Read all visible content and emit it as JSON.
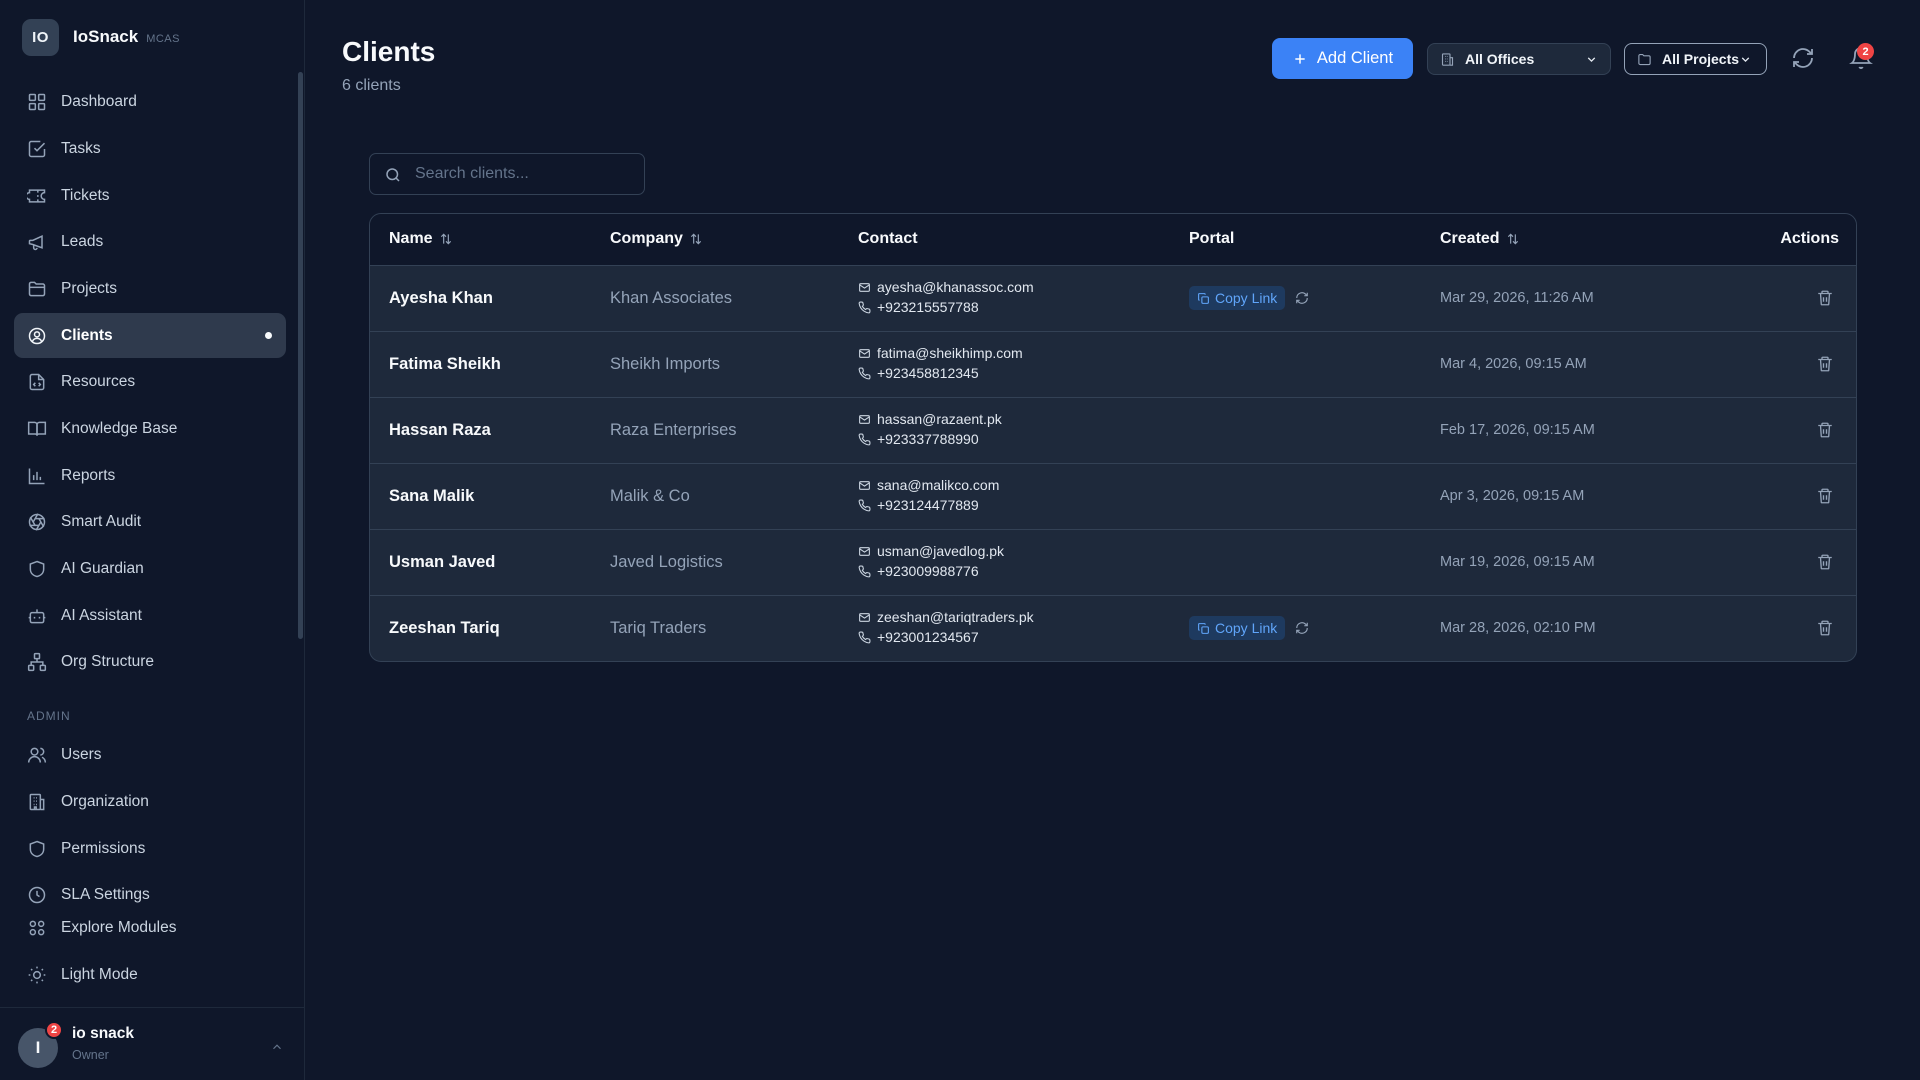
{
  "brand": {
    "logo_text": "IO",
    "name": "IoSnack",
    "tag": "MCAS"
  },
  "sidebar": {
    "items": [
      {
        "label": "Dashboard",
        "icon": "grid-icon"
      },
      {
        "label": "Tasks",
        "icon": "checkbox-icon"
      },
      {
        "label": "Tickets",
        "icon": "ticket-icon"
      },
      {
        "label": "Leads",
        "icon": "megaphone-icon"
      },
      {
        "label": "Projects",
        "icon": "folder-icon"
      },
      {
        "label": "Clients",
        "icon": "user-circle-icon",
        "active": true
      },
      {
        "label": "Resources",
        "icon": "file-icon"
      },
      {
        "label": "Knowledge Base",
        "icon": "book-icon"
      },
      {
        "label": "Reports",
        "icon": "bar-chart-icon"
      },
      {
        "label": "Smart Audit",
        "icon": "aperture-icon"
      },
      {
        "label": "AI Guardian",
        "icon": "shield-icon"
      },
      {
        "label": "AI Assistant",
        "icon": "bot-icon"
      },
      {
        "label": "Org Structure",
        "icon": "network-icon"
      }
    ],
    "admin_label": "ADMIN",
    "admin_items": [
      {
        "label": "Users",
        "icon": "users-icon"
      },
      {
        "label": "Organization",
        "icon": "building-icon"
      },
      {
        "label": "Permissions",
        "icon": "shield-icon"
      },
      {
        "label": "SLA Settings",
        "icon": "clock-icon"
      }
    ],
    "explore_label": "Explore Modules",
    "theme_label": "Light Mode"
  },
  "user": {
    "initial": "I",
    "name": "io snack",
    "role": "Owner",
    "badge": "2"
  },
  "header": {
    "title": "Clients",
    "subtitle": "6 clients",
    "add_button": "Add Client",
    "offices_select": "All Offices",
    "projects_select": "All Projects",
    "notification_count": "2"
  },
  "search": {
    "placeholder": "Search clients..."
  },
  "table": {
    "columns": {
      "name": "Name",
      "company": "Company",
      "contact": "Contact",
      "portal": "Portal",
      "created": "Created",
      "actions": "Actions"
    },
    "copy_link_label": "Copy Link",
    "rows": [
      {
        "name": "Ayesha Khan",
        "company": "Khan Associates",
        "email": "ayesha@khanassoc.com",
        "phone": "+923215557788",
        "portal": true,
        "created": "Mar 29, 2026, 11:26 AM"
      },
      {
        "name": "Fatima Sheikh",
        "company": "Sheikh Imports",
        "email": "fatima@sheikhimp.com",
        "phone": "+923458812345",
        "portal": false,
        "created": "Mar 4, 2026, 09:15 AM"
      },
      {
        "name": "Hassan Raza",
        "company": "Raza Enterprises",
        "email": "hassan@razaent.pk",
        "phone": "+923337788990",
        "portal": false,
        "created": "Feb 17, 2026, 09:15 AM"
      },
      {
        "name": "Sana Malik",
        "company": "Malik & Co",
        "email": "sana@malikco.com",
        "phone": "+923124477889",
        "portal": false,
        "created": "Apr 3, 2026, 09:15 AM"
      },
      {
        "name": "Usman Javed",
        "company": "Javed Logistics",
        "email": "usman@javedlog.pk",
        "phone": "+923009988776",
        "portal": false,
        "created": "Mar 19, 2026, 09:15 AM"
      },
      {
        "name": "Zeeshan Tariq",
        "company": "Tariq Traders",
        "email": "zeeshan@tariqtraders.pk",
        "phone": "+923001234567",
        "portal": true,
        "created": "Mar 28, 2026, 02:10 PM"
      }
    ]
  }
}
